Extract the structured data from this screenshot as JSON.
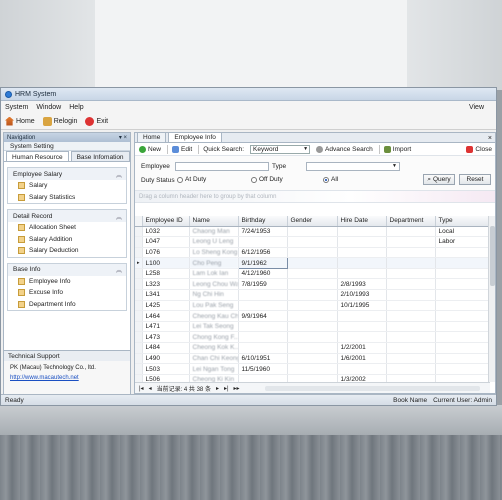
{
  "window": {
    "title": "HRM System"
  },
  "menu": {
    "items": [
      "System",
      "Window",
      "Help"
    ],
    "view": "View"
  },
  "toolbar": {
    "home": "Home",
    "relogin": "Relogin",
    "exit": "Exit"
  },
  "nav": {
    "title": "Navigation",
    "pin": "▾ ×",
    "section": "System Setting",
    "tabs": [
      "Human Resource",
      "Base Infomation"
    ],
    "groups": [
      {
        "title": "Employee Salary",
        "items": [
          "Salary",
          "Salary Statistics"
        ]
      },
      {
        "title": "Detail Record",
        "items": [
          "Allocation Sheet",
          "Salary Addition",
          "Salary Deduction"
        ]
      },
      {
        "title": "Base Info",
        "items": [
          "Employee Info",
          "Excuse Info",
          "Department Info"
        ]
      }
    ],
    "support": {
      "title": "Technical Support",
      "company": "PK (Macau) Technology Co., ltd.",
      "link": "http://www.macautech.net"
    }
  },
  "main": {
    "tabs": [
      "Home",
      "Employee Info"
    ],
    "actions": {
      "new": "New",
      "edit": "Edit",
      "quick_search": "Quick Search:",
      "keyword": "Keyword",
      "advance_search": "Advance Search",
      "import": "Import",
      "close": "Close"
    },
    "filter": {
      "employee_label": "Employee",
      "type_label": "Type",
      "duty_label": "Duty Status",
      "at_duty": "At Duty",
      "off_duty": "Off Duty",
      "all": "All",
      "query": "Query",
      "reset": "Reset"
    },
    "group_hint": "Drag a column header here to group by that column",
    "columns": [
      "Employee ID",
      "Name",
      "Birthday",
      "Gender",
      "Hire Date",
      "Department",
      "Type"
    ],
    "rows": [
      [
        "L032",
        "Chaong Man",
        "7/24/1953",
        "",
        "",
        "",
        "Local"
      ],
      [
        "L047",
        "Leong U Leng",
        "",
        "",
        "",
        "",
        "Labor"
      ],
      [
        "L076",
        "Lo Sheng Kong",
        "6/12/1956",
        "",
        "",
        "",
        ""
      ],
      [
        "L100",
        "Cho Peng",
        "9/1/1962",
        "",
        "",
        "",
        ""
      ],
      [
        "L258",
        "Lam Lok Ian",
        "4/12/1960",
        "",
        "",
        "",
        ""
      ],
      [
        "L323",
        "Leong Chou Wai",
        "7/8/1959",
        "",
        "2/8/1993",
        "",
        ""
      ],
      [
        "L341",
        "Ng Chi Hin",
        "",
        "",
        "2/10/1993",
        "",
        ""
      ],
      [
        "L425",
        "Lou Pak Seng",
        "",
        "",
        "10/1/1995",
        "",
        ""
      ],
      [
        "L464",
        "Cheong Kau Choi",
        "9/9/1964",
        "",
        "",
        "",
        ""
      ],
      [
        "L471",
        "Lei Tak Seong",
        "",
        "",
        "",
        "",
        ""
      ],
      [
        "L473",
        "Chong Kong F...",
        "",
        "",
        "",
        "",
        ""
      ],
      [
        "L484",
        "Cheong Kok K...",
        "",
        "",
        "1/2/2001",
        "",
        ""
      ],
      [
        "L490",
        "Chan Chi Keong",
        "6/10/1951",
        "",
        "1/6/2001",
        "",
        ""
      ],
      [
        "L503",
        "Lei Ngan Tong",
        "11/5/1960",
        "",
        "",
        "",
        ""
      ],
      [
        "L506",
        "Cheong Ki Kin",
        "",
        "",
        "1/3/2002",
        "",
        ""
      ],
      [
        "L511",
        "Pang Nam Kuong",
        "",
        "",
        "1/3/2002",
        "",
        ""
      ]
    ],
    "selected_row": "▸",
    "pager": {
      "first": "|◂",
      "prev": "◂",
      "text": "当前记录: 4 共 38 条",
      "next": "▸",
      "last": "▸|",
      "more": "▸▸"
    }
  },
  "status": {
    "left": "Ready",
    "book": "Book Name",
    "user": "Current User: Admin"
  }
}
